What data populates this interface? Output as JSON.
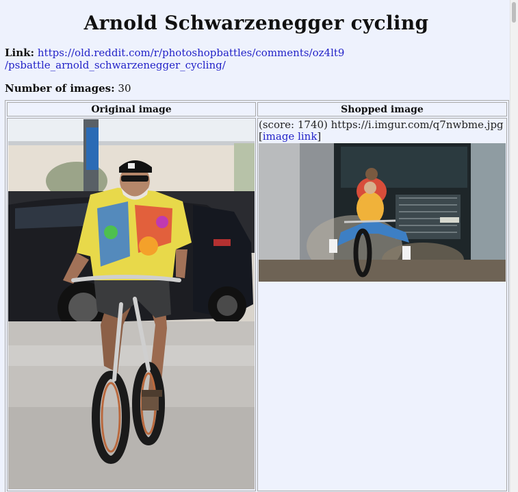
{
  "page": {
    "title": "Arnold Schwarzenegger cycling",
    "link_label": "Link:",
    "link_url_line1": "https://old.reddit.com/r/photoshopbattles/comments/oz4lt9",
    "link_url_line2": "/psbattle_arnold_schwarzenegger_cycling/",
    "count_label": "Number of images:",
    "count_value": "30"
  },
  "table": {
    "header_original": "Original image",
    "header_shopped": "Shopped image",
    "rows": [
      {
        "score_text": "(score: 1740) https://i.imgur.com/q7nwbme.jpg",
        "image_link_open": "[",
        "image_link_label": "image link",
        "image_link_close": "]"
      }
    ]
  }
}
